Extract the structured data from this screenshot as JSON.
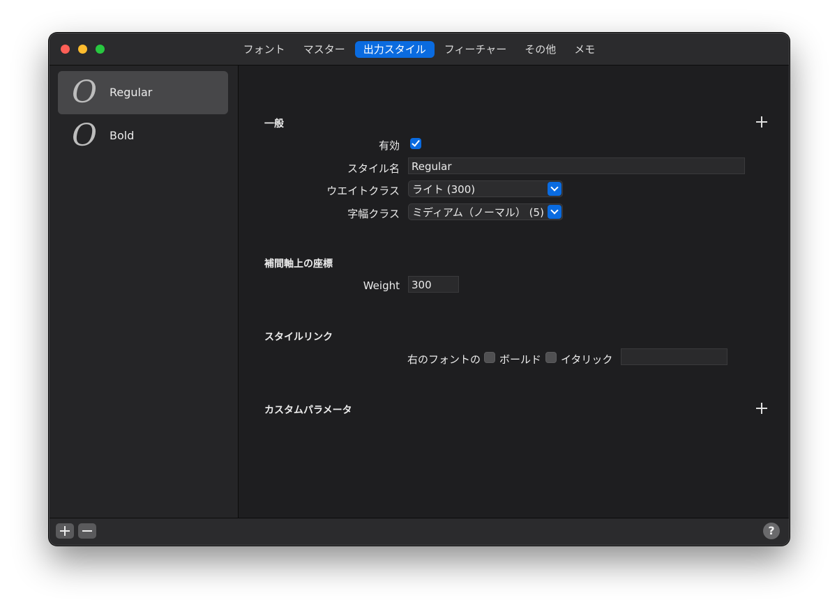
{
  "tabs": [
    {
      "label": "フォント",
      "active": false
    },
    {
      "label": "マスター",
      "active": false
    },
    {
      "label": "出力スタイル",
      "active": true
    },
    {
      "label": "フィーチャー",
      "active": false
    },
    {
      "label": "その他",
      "active": false
    },
    {
      "label": "メモ",
      "active": false
    }
  ],
  "sidebar": {
    "items": [
      {
        "glyph": "O",
        "name": "Regular",
        "selected": true
      },
      {
        "glyph": "O",
        "name": "Bold",
        "selected": false
      }
    ]
  },
  "general": {
    "title": "一般",
    "active_label": "有効",
    "active_checked": true,
    "style_name_label": "スタイル名",
    "style_name_value": "Regular",
    "weight_class_label": "ウエイトクラス",
    "weight_class_value": "ライト (300)",
    "width_class_label": "字幅クラス",
    "width_class_value": "ミディアム（ノーマル） (5)"
  },
  "axes": {
    "title": "補間軸上の座標",
    "weight_label": "Weight",
    "weight_value": "300"
  },
  "style_link": {
    "title": "スタイルリンク",
    "prefix": "右のフォントの",
    "bold_label": "ボールド",
    "italic_label": "イタリック",
    "bold_checked": false,
    "italic_checked": false,
    "linked_value": ""
  },
  "custom_params": {
    "title": "カスタムパラメータ"
  },
  "bottom": {
    "help_label": "?"
  },
  "colors": {
    "accent": "#0a6be0",
    "window_bg": "#1e1e20",
    "sidebar_bg": "#252527",
    "selected_bg": "#474749"
  }
}
